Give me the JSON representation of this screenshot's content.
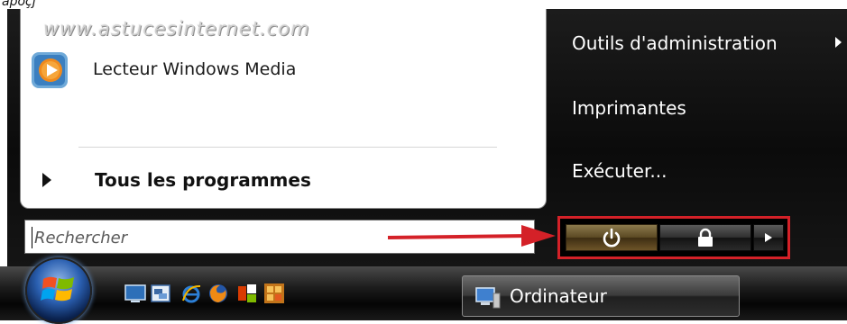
{
  "cropped_top_text": "apoçj",
  "watermark": "www.astucesinternet.com",
  "left_panel": {
    "program": {
      "label": "Lecteur Windows Media",
      "icon": "windows-media-player-icon"
    },
    "all_programs_label": "Tous les programmes"
  },
  "search": {
    "placeholder": "Rechercher",
    "value": ""
  },
  "right_column": {
    "items": [
      {
        "label": "Outils d'administration",
        "has_submenu": true
      },
      {
        "label": "Imprimantes"
      },
      {
        "label": "Exécuter..."
      }
    ]
  },
  "power_buttons": {
    "power_icon": "power-icon",
    "lock_icon": "lock-icon",
    "more_icon": "arrow-right-icon",
    "highlight_color": "#d42128"
  },
  "annotation": {
    "arrow_color": "#d42128"
  },
  "taskbar": {
    "quick_launch": [
      "show-desktop-icon",
      "switch-windows-icon",
      "internet-explorer-icon",
      "firefox-icon",
      "office-icon",
      "grid-app-icon"
    ],
    "window_button_label": "Ordinateur"
  }
}
